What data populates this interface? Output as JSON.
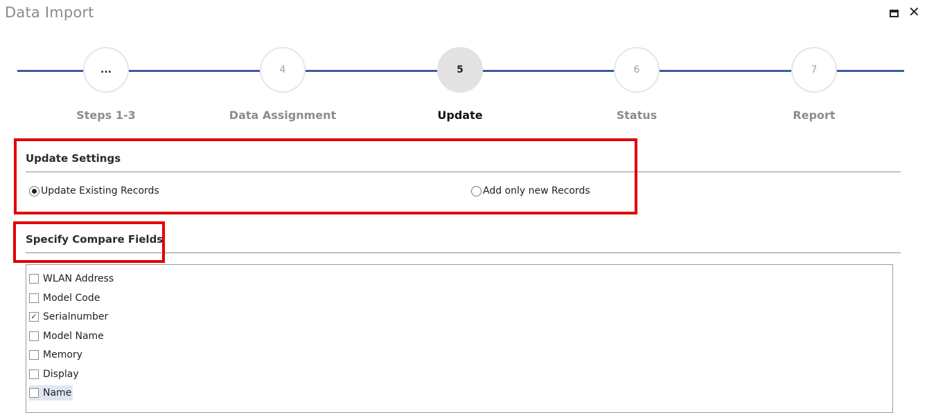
{
  "window": {
    "title": "Data Import",
    "maximize_icon": "maximize-icon",
    "close_glyph": "✕"
  },
  "wizard": {
    "steps": [
      {
        "number": "...",
        "label": "Steps 1-3",
        "state": "done"
      },
      {
        "number": "4",
        "label": "Data Assignment",
        "state": "done"
      },
      {
        "number": "5",
        "label": "Update",
        "state": "active"
      },
      {
        "number": "6",
        "label": "Status",
        "state": "pending"
      },
      {
        "number": "7",
        "label": "Report",
        "state": "pending"
      }
    ],
    "line_color": "#3a5b9e"
  },
  "update_settings": {
    "header": "Update Settings",
    "options": [
      {
        "label": "Update Existing Records",
        "checked": true
      },
      {
        "label": "Add only new Records",
        "checked": false
      }
    ]
  },
  "compare_fields": {
    "header": "Specify Compare Fields",
    "items": [
      {
        "label": "WLAN Address",
        "checked": false
      },
      {
        "label": "Model Code",
        "checked": false
      },
      {
        "label": "Serialnumber",
        "checked": true
      },
      {
        "label": "Model Name",
        "checked": false
      },
      {
        "label": "Memory",
        "checked": false
      },
      {
        "label": "Display",
        "checked": false
      },
      {
        "label": "Name",
        "checked": false,
        "selected": true
      }
    ]
  },
  "colors": {
    "highlight": "#e10000",
    "selection": "#dfe6f3"
  }
}
